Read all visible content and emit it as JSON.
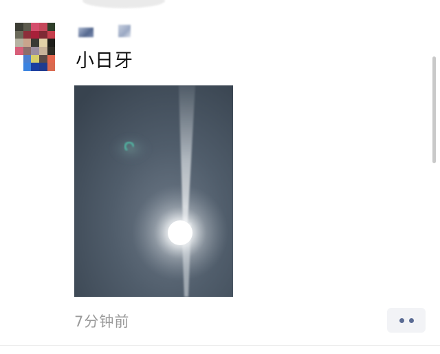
{
  "post": {
    "text": "小日牙",
    "timestamp": "7分钟前",
    "more_icon": "more-dots-icon",
    "image_icon": "photo-sun-eclipse"
  },
  "colors": {
    "more_dots": "#5a6b93",
    "more_bg": "#f2f3f6",
    "timestamp": "#9a9a9a",
    "text": "#111111"
  }
}
